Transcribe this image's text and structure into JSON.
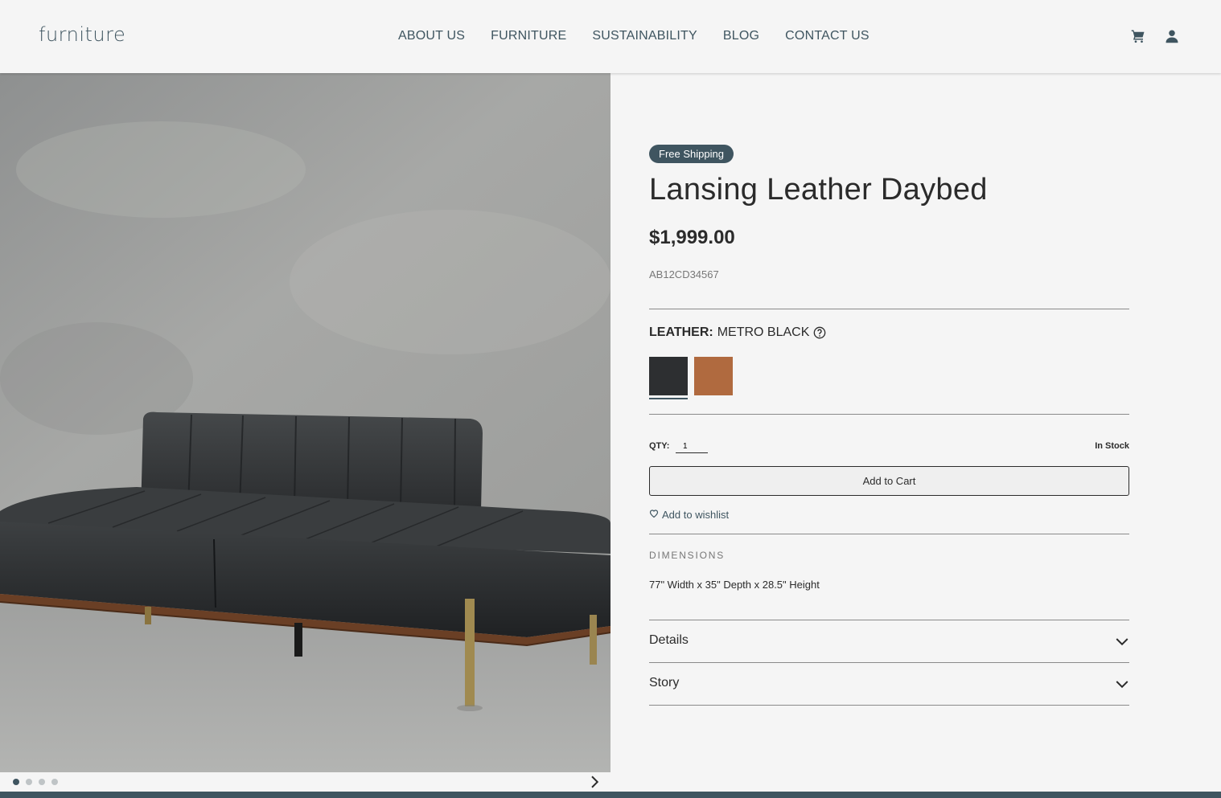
{
  "header": {
    "logo": "furniture",
    "nav": [
      "ABOUT US",
      "FURNITURE",
      "SUSTAINABILITY",
      "BLOG",
      "CONTACT US"
    ],
    "icons": [
      "cart-icon",
      "user-icon"
    ]
  },
  "gallery": {
    "slide_count": 4,
    "active_slide": 1,
    "icons": [
      "chevron-right-icon"
    ]
  },
  "product": {
    "badge": "Free Shipping",
    "title": "Lansing Leather Daybed",
    "price": "$1,999.00",
    "sku": "AB12CD34567",
    "option_label": "LEATHER:",
    "option_value": "METRO BLACK",
    "swatches": [
      {
        "name": "Metro Black",
        "color": "#2d2f31",
        "selected": true
      },
      {
        "name": "Cognac",
        "color": "#b06a3f",
        "selected": false
      }
    ],
    "qty_label": "QTY:",
    "qty_value": "1",
    "stock": "In Stock",
    "add_to_cart": "Add to Cart",
    "wishlist": "Add to wishlist",
    "dimensions_title": "DIMENSIONS",
    "dimensions_value": "77\" Width x 35\" Depth x 28.5\" Height",
    "accordions": [
      "Details",
      "Story"
    ]
  },
  "colors": {
    "accent": "#3f5560",
    "background": "#f5f5f5"
  }
}
